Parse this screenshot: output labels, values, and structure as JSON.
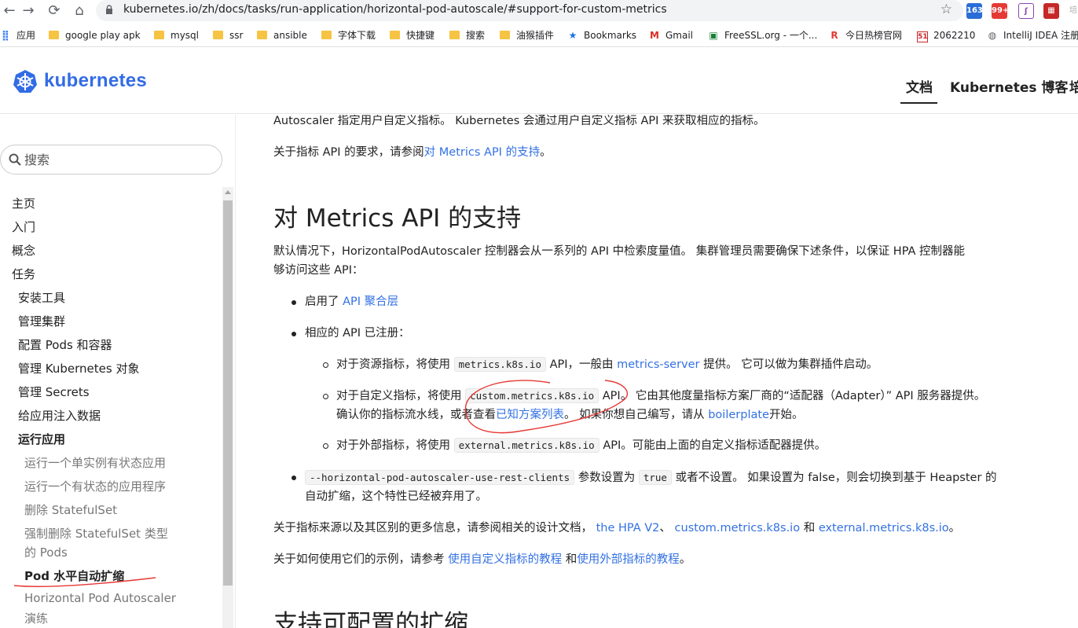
{
  "browser": {
    "url_host": "kubernetes.io",
    "url_path": "/zh/docs/tasks/run-application/horizontal-pod-autoscale/#support-for-custom-metrics",
    "extensions": [
      {
        "icon": "mail-163-icon",
        "badge": "163",
        "color": "#2b6dd6"
      },
      {
        "icon": "notification-icon",
        "badge": "99+",
        "color": "#e53935"
      },
      {
        "icon": "script-extension-icon",
        "badge": "",
        "color": "#8e44ad"
      },
      {
        "icon": "grid-extension-icon",
        "badge": "",
        "color": "#c62828"
      }
    ],
    "bookmarks": [
      {
        "label": "应用",
        "icon": "apps-icon"
      },
      {
        "label": "google play apk",
        "icon": "folder-icon"
      },
      {
        "label": "mysql",
        "icon": "folder-icon"
      },
      {
        "label": "ssr",
        "icon": "folder-icon"
      },
      {
        "label": "ansible",
        "icon": "folder-icon"
      },
      {
        "label": "字体下载",
        "icon": "folder-icon"
      },
      {
        "label": "快捷键",
        "icon": "folder-icon"
      },
      {
        "label": "搜索",
        "icon": "folder-icon"
      },
      {
        "label": "油猴插件",
        "icon": "folder-icon"
      },
      {
        "label": "Bookmarks",
        "icon": "star-icon"
      },
      {
        "label": "Gmail",
        "icon": "gmail-icon"
      },
      {
        "label": "FreeSSL.org - 一个...",
        "icon": "lock-icon"
      },
      {
        "label": "今日热榜官网",
        "icon": "r-logo-icon"
      },
      {
        "label": "2062210",
        "icon": "51-logo-icon"
      },
      {
        "label": "IntelliJ IDEA 注册",
        "icon": "globe-icon"
      }
    ]
  },
  "header": {
    "logo_text": "kubernetes",
    "nav": [
      "文档",
      "Kubernetes 博客",
      "培"
    ]
  },
  "sidebar": {
    "search_placeholder": "搜索",
    "items": [
      {
        "label": "主页",
        "level": 1
      },
      {
        "label": "入门",
        "level": 1
      },
      {
        "label": "概念",
        "level": 1
      },
      {
        "label": "任务",
        "level": 1
      },
      {
        "label": "安装工具",
        "level": 2
      },
      {
        "label": "管理集群",
        "level": 2
      },
      {
        "label": "配置 Pods 和容器",
        "level": 2
      },
      {
        "label": "管理 Kubernetes 对象",
        "level": 2
      },
      {
        "label": "管理 Secrets",
        "level": 2
      },
      {
        "label": "给应用注入数据",
        "level": 2
      },
      {
        "label": "运行应用",
        "level": 2
      },
      {
        "label": "运行一个单实例有状态应用",
        "level": 3
      },
      {
        "label": "运行一个有状态的应用程序",
        "level": 3
      },
      {
        "label": "删除 StatefulSet",
        "level": 3
      },
      {
        "label": "强制删除 StatefulSet 类型",
        "level": 3
      },
      {
        "label": "的 Pods",
        "level": 3
      },
      {
        "label": "Pod 水平自动扩缩",
        "level": 3
      },
      {
        "label": "Horizontal Pod Autoscaler",
        "level": 3
      },
      {
        "label": "演练",
        "level": 3
      }
    ]
  },
  "content": {
    "intro_line": "Autoscaler 指定用户自定义指标。 Kubernetes 会通过用户自定义指标 API 来获取相应的指标。",
    "req_prefix": "关于指标 API 的要求，请参阅",
    "req_link": "对 Metrics API 的支持",
    "req_suffix": "。",
    "h2_metrics": "对 Metrics API 的支持",
    "para1_line1": "默认情况下，HorizontalPodAutoscaler 控制器会从一系列的 API 中检索度量值。 集群管理员需要确保下述条件，以保证 HPA 控制器能",
    "para1_line2": "够访问这些 API：",
    "b1_prefix": "启用了 ",
    "b1_link": "API 聚合层",
    "b2_text": "相应的 API 已注册：",
    "s1_prefix": "对于资源指标，将使用",
    "s1_code": "metrics.k8s.io",
    "s1_mid": "API，一般由",
    "s1_link": "metrics-server",
    "s1_suffix": "提供。 它可以做为集群插件启动。",
    "s2_prefix": "对于自定义指标，将使用",
    "s2_code": "custom.metrics.k8s.io",
    "s2_suffix": "API。 它由其他度量指标方案厂商的“适配器（Adapter）” API 服务器提供。",
    "s2_line2_prefix": "确认你的指标流水线，或者查看",
    "s2_link": "已知方案列表",
    "s2_line2_mid": "。 如果你想自己编写，请从",
    "s2_link2": "boilerplate",
    "s2_line2_suffix": "开始。",
    "s3_prefix": "对于外部指标，将使用",
    "s3_code": "external.metrics.k8s.io",
    "s3_suffix": "API。可能由上面的自定义指标适配器提供。",
    "b3_code": "--horizontal-pod-autoscaler-use-rest-clients",
    "b3_mid": "参数设置为",
    "b3_code2": "true",
    "b3_suffix": "或者不设置。 如果设置为 false，则会切换到基于 Heapster 的",
    "b3_line2": "自动扩缩，这个特性已经被弃用了。",
    "more_prefix": "关于指标来源以及其区别的更多信息，请参阅相关的设计文档，",
    "more_link1": "the HPA V2",
    "more_sep1": "、",
    "more_link2": "custom.metrics.k8s.io",
    "more_sep2": "和",
    "more_link3": "external.metrics.k8s.io",
    "more_suffix": "。",
    "usage_prefix": "关于如何使用它们的示例，请参考",
    "usage_link1": "使用自定义指标的教程",
    "usage_sep": "和",
    "usage_link2": "使用外部指标的教程",
    "usage_suffix": "。",
    "h2_next": "支持可配置的扩缩"
  },
  "colors": {
    "brand": "#326ce5",
    "link": "#3371e3",
    "annotation": "#e53935"
  }
}
